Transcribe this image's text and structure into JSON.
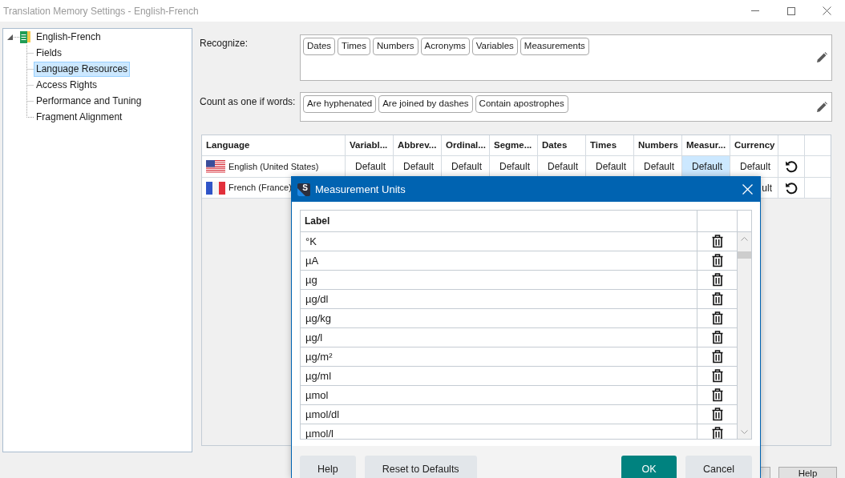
{
  "window": {
    "title": "Translation Memory Settings - English-French"
  },
  "tree": {
    "label": "English-French",
    "expanded": true,
    "children": [
      {
        "label": "Fields",
        "selected": false
      },
      {
        "label": "Language Resources",
        "selected": true
      },
      {
        "label": "Access Rights",
        "selected": false
      },
      {
        "label": "Performance and Tuning",
        "selected": false
      },
      {
        "label": "Fragment Alignment",
        "selected": false
      }
    ]
  },
  "recognize": {
    "label": "Recognize:",
    "tags": [
      "Dates",
      "Times",
      "Numbers",
      "Acronyms",
      "Variables",
      "Measurements"
    ]
  },
  "count_as_one": {
    "label": "Count as one if words:",
    "tags": [
      "Are hyphenated",
      "Are joined by dashes",
      "Contain apostrophes"
    ]
  },
  "language_table": {
    "columns": [
      "Language",
      "Variabl...",
      "Abbrev...",
      "Ordinal...",
      "Segme...",
      "Dates",
      "Times",
      "Numbers",
      "Measur...",
      "Currency"
    ],
    "rows": [
      {
        "kind": "us",
        "cells": [
          {
            "text": "English (United States)",
            "selected": false
          },
          {
            "text": "Default",
            "selected": false
          },
          {
            "text": "Default",
            "selected": false
          },
          {
            "text": "Default",
            "selected": false
          },
          {
            "text": "Default",
            "selected": false
          },
          {
            "text": "Default",
            "selected": false
          },
          {
            "text": "Default",
            "selected": false
          },
          {
            "text": "Default",
            "selected": false
          },
          {
            "text": "Default",
            "selected": true
          },
          {
            "text": "Default",
            "selected": false
          }
        ]
      },
      {
        "kind": "fr",
        "cells": [
          {
            "text": "French (France)",
            "selected": false
          },
          null,
          null,
          null,
          null,
          null,
          null,
          null,
          null,
          {
            "text": "ult",
            "selected": false
          }
        ]
      }
    ]
  },
  "footer": {
    "buttons": [
      "Help"
    ]
  },
  "dialog": {
    "logo": "S",
    "title": "Measurement Units",
    "column": "Label",
    "rows": [
      "°K",
      "µA",
      "µg",
      "µg/dl",
      "µg/kg",
      "µg/l",
      "µg/m²",
      "µg/ml",
      "µmol",
      "µmol/dl",
      "µmol/l"
    ],
    "left_buttons": [
      {
        "label": "Help",
        "kind": "default"
      },
      {
        "label": "Reset to Defaults",
        "kind": "default"
      }
    ],
    "right_buttons": [
      {
        "label": "OK",
        "kind": "primary"
      },
      {
        "label": "Cancel",
        "kind": "default"
      }
    ]
  }
}
